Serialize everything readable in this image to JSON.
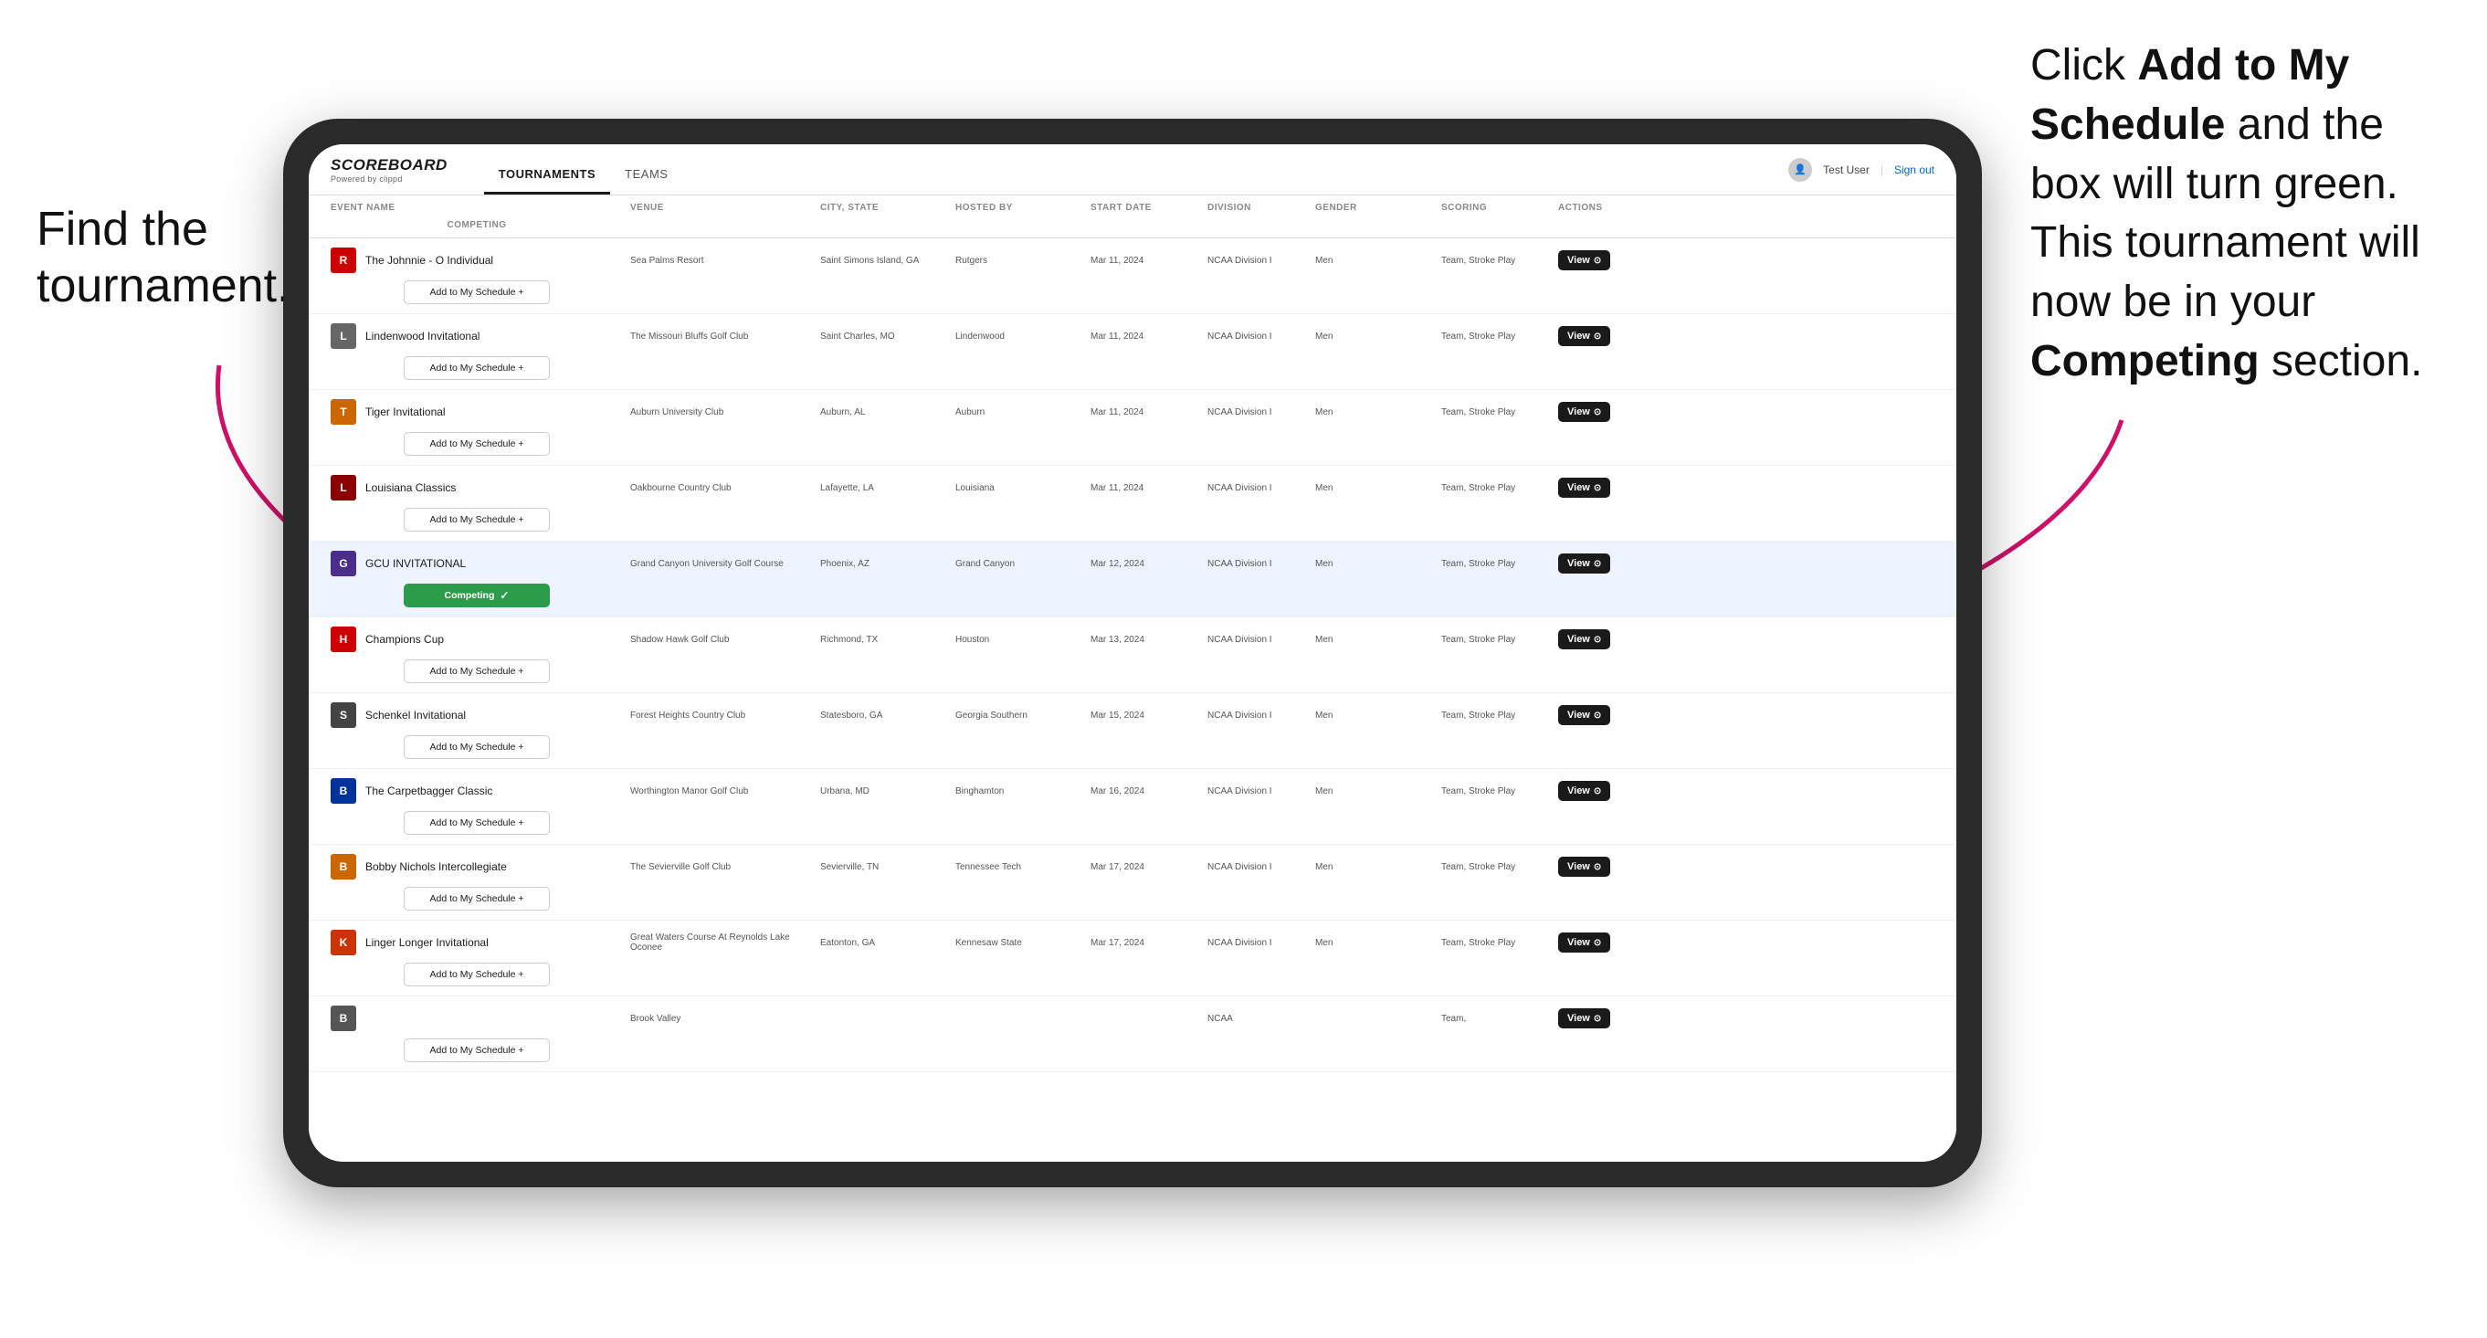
{
  "annotations": {
    "left_text_line1": "Find the",
    "left_text_line2": "tournament.",
    "right_text": "Click Add to My Schedule and the box will turn green. This tournament will now be in your Competing section.",
    "right_bold1": "Add to My Schedule",
    "right_bold2": "Competing"
  },
  "app": {
    "logo": "SCOREBOARD",
    "logo_sub": "Powered by clippd",
    "nav": {
      "tabs": [
        "TOURNAMENTS",
        "TEAMS"
      ],
      "active": "TOURNAMENTS"
    },
    "user": "Test User",
    "signout": "Sign out"
  },
  "table": {
    "columns": [
      "EVENT NAME",
      "VENUE",
      "CITY, STATE",
      "HOSTED BY",
      "START DATE",
      "DIVISION",
      "GENDER",
      "SCORING",
      "ACTIONS",
      "COMPETING"
    ],
    "rows": [
      {
        "id": 1,
        "logo_color": "#cc0000",
        "logo_letter": "R",
        "event_name": "The Johnnie - O Individual",
        "venue": "Sea Palms Resort",
        "city_state": "Saint Simons Island, GA",
        "hosted_by": "Rutgers",
        "start_date": "Mar 11, 2024",
        "division": "NCAA Division I",
        "gender": "Men",
        "scoring": "Team, Stroke Play",
        "competing_status": "add",
        "btn_label": "Add to My Schedule +"
      },
      {
        "id": 2,
        "logo_color": "#333",
        "logo_letter": "L",
        "event_name": "Lindenwood Invitational",
        "venue": "The Missouri Bluffs Golf Club",
        "city_state": "Saint Charles, MO",
        "hosted_by": "Lindenwood",
        "start_date": "Mar 11, 2024",
        "division": "NCAA Division I",
        "gender": "Men",
        "scoring": "Team, Stroke Play",
        "competing_status": "add",
        "btn_label": "Add to My Schedule +"
      },
      {
        "id": 3,
        "logo_color": "#cc6600",
        "logo_letter": "T",
        "event_name": "Tiger Invitational",
        "venue": "Auburn University Club",
        "city_state": "Auburn, AL",
        "hosted_by": "Auburn",
        "start_date": "Mar 11, 2024",
        "division": "NCAA Division I",
        "gender": "Men",
        "scoring": "Team, Stroke Play",
        "competing_status": "add",
        "btn_label": "Add to My Schedule +"
      },
      {
        "id": 4,
        "logo_color": "#990000",
        "logo_letter": "L",
        "event_name": "Louisiana Classics",
        "venue": "Oakbourne Country Club",
        "city_state": "Lafayette, LA",
        "hosted_by": "Louisiana",
        "start_date": "Mar 11, 2024",
        "division": "NCAA Division I",
        "gender": "Men",
        "scoring": "Team, Stroke Play",
        "competing_status": "add",
        "btn_label": "Add to My Schedule +"
      },
      {
        "id": 5,
        "logo_color": "#4a2d8c",
        "logo_letter": "G",
        "event_name": "GCU INVITATIONAL",
        "venue": "Grand Canyon University Golf Course",
        "city_state": "Phoenix, AZ",
        "hosted_by": "Grand Canyon",
        "start_date": "Mar 12, 2024",
        "division": "NCAA Division I",
        "gender": "Men",
        "scoring": "Team, Stroke Play",
        "competing_status": "competing",
        "btn_label": "Competing",
        "highlighted": true
      },
      {
        "id": 6,
        "logo_color": "#cc0000",
        "logo_letter": "H",
        "event_name": "Champions Cup",
        "venue": "Shadow Hawk Golf Club",
        "city_state": "Richmond, TX",
        "hosted_by": "Houston",
        "start_date": "Mar 13, 2024",
        "division": "NCAA Division I",
        "gender": "Men",
        "scoring": "Team, Stroke Play",
        "competing_status": "add",
        "btn_label": "Add to My Schedule +"
      },
      {
        "id": 7,
        "logo_color": "#333",
        "logo_letter": "S",
        "event_name": "Schenkel Invitational",
        "venue": "Forest Heights Country Club",
        "city_state": "Statesboro, GA",
        "hosted_by": "Georgia Southern",
        "start_date": "Mar 15, 2024",
        "division": "NCAA Division I",
        "gender": "Men",
        "scoring": "Team, Stroke Play",
        "competing_status": "add",
        "btn_label": "Add to My Schedule +"
      },
      {
        "id": 8,
        "logo_color": "#003399",
        "logo_letter": "B",
        "event_name": "The Carpetbagger Classic",
        "venue": "Worthington Manor Golf Club",
        "city_state": "Urbana, MD",
        "hosted_by": "Binghamton",
        "start_date": "Mar 16, 2024",
        "division": "NCAA Division I",
        "gender": "Men",
        "scoring": "Team, Stroke Play",
        "competing_status": "add",
        "btn_label": "Add to My Schedule +"
      },
      {
        "id": 9,
        "logo_color": "#cc6600",
        "logo_letter": "B",
        "event_name": "Bobby Nichols Intercollegiate",
        "venue": "The Sevierville Golf Club",
        "city_state": "Sevierville, TN",
        "hosted_by": "Tennessee Tech",
        "start_date": "Mar 17, 2024",
        "division": "NCAA Division I",
        "gender": "Men",
        "scoring": "Team, Stroke Play",
        "competing_status": "add",
        "btn_label": "Add to My Schedule +"
      },
      {
        "id": 10,
        "logo_color": "#cc3300",
        "logo_letter": "K",
        "event_name": "Linger Longer Invitational",
        "venue": "Great Waters Course At Reynolds Lake Oconee",
        "city_state": "Eatonton, GA",
        "hosted_by": "Kennesaw State",
        "start_date": "Mar 17, 2024",
        "division": "NCAA Division I",
        "gender": "Men",
        "scoring": "Team, Stroke Play",
        "competing_status": "add",
        "btn_label": "Add to My Schedule +"
      },
      {
        "id": 11,
        "logo_color": "#555",
        "logo_letter": "B",
        "event_name": "",
        "venue": "Brook Valley",
        "city_state": "",
        "hosted_by": "",
        "start_date": "",
        "division": "NCAA",
        "gender": "",
        "scoring": "Team,",
        "competing_status": "add",
        "btn_label": "Add to My Schedule +"
      }
    ],
    "view_btn_label": "View",
    "competing_check": "✓"
  }
}
